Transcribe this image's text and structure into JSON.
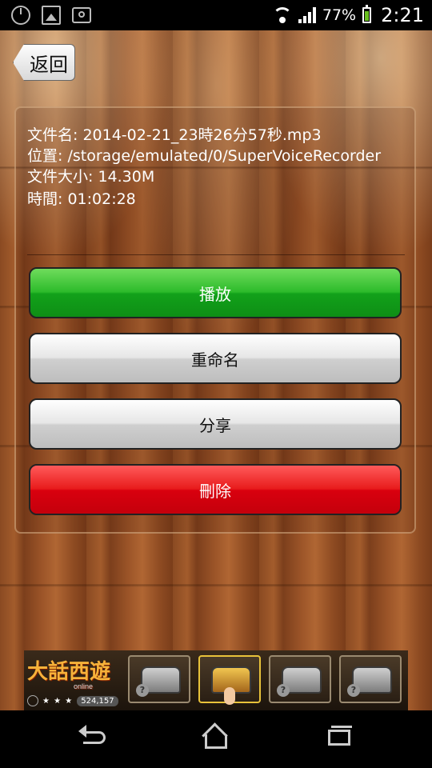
{
  "status_bar": {
    "battery_percent": "77%",
    "time": "2:21"
  },
  "header": {
    "back_label": "返回"
  },
  "file_info": {
    "name": "文件名: 2014-02-21_23時26分57秒.mp3",
    "location": "位置: /storage/emulated/0/SuperVoiceRecorder",
    "size": "文件大小: 14.30M",
    "duration": "時間: 01:02:28"
  },
  "actions": {
    "play": "播放",
    "rename": "重命名",
    "share": "分享",
    "delete": "刪除"
  },
  "ad": {
    "title": "大話西遊",
    "subtitle": "online",
    "stars": "★ ★ ★",
    "rating_count": "524,157",
    "chest_mark": "?"
  },
  "colors": {
    "play_button": "#12a11a",
    "delete_button": "#d9000e",
    "neutral_button": "#d9d9d9"
  }
}
